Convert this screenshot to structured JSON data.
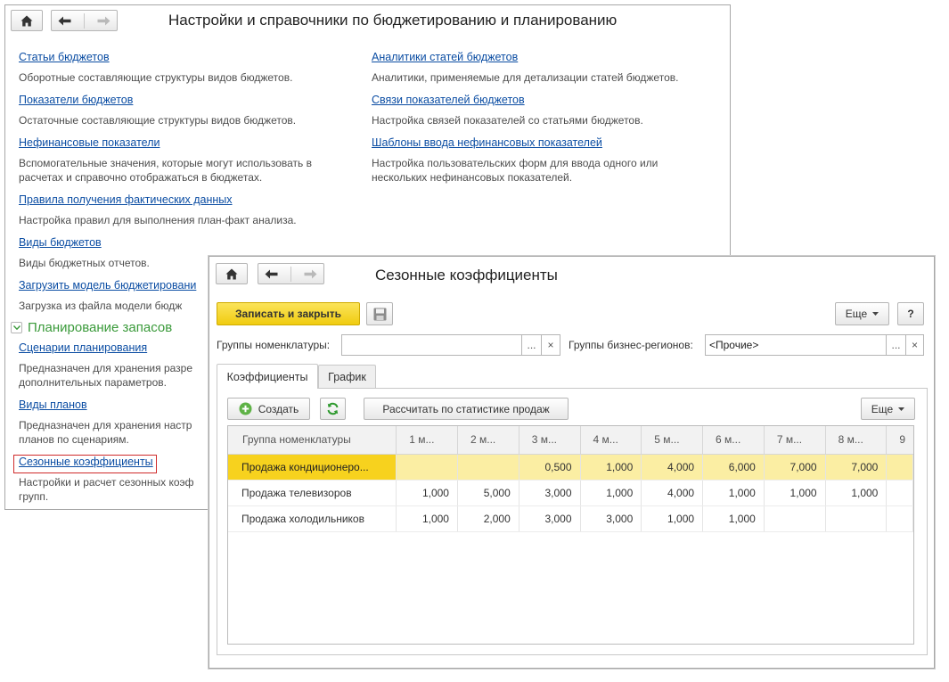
{
  "settings_window": {
    "title": "Настройки и справочники по бюджетированию и планированию",
    "left_column": [
      {
        "link": "Статьи бюджетов",
        "desc": [
          "Оборотные составляющие структуры видов бюджетов."
        ]
      },
      {
        "link": "Показатели бюджетов",
        "desc": [
          "Остаточные составляющие структуры видов бюджетов."
        ]
      },
      {
        "link": "Нефинансовые показатели",
        "desc": [
          "Вспомогательные значения, которые могут использовать в",
          "расчетах и справочно отображаться в бюджетах."
        ]
      },
      {
        "link": "Правила получения фактических данных",
        "desc": [
          "Настройка правил для выполнения план-факт анализа."
        ]
      },
      {
        "link": "Виды бюджетов",
        "desc": [
          "Виды бюджетных отчетов."
        ]
      },
      {
        "link": "Загрузить модель бюджетировани",
        "desc": [
          "Загрузка из файла модели бюдж"
        ]
      }
    ],
    "right_column": [
      {
        "link": "Аналитики статей бюджетов",
        "desc": [
          "Аналитики, применяемые для детализации статей бюджетов."
        ]
      },
      {
        "link": "Связи показателей бюджетов",
        "desc": [
          "Настройка связей показателей со статьями бюджетов."
        ]
      },
      {
        "link": "Шаблоны ввода нефинансовых показателей",
        "desc": [
          "Настройка пользовательских форм для ввода одного или",
          "нескольких нефинансовых показателей."
        ]
      }
    ],
    "group_title": "Планирование запасов",
    "group_items": [
      {
        "link": "Сценарии планирования",
        "desc": [
          "Предназначен для хранения разре",
          "дополнительных параметров."
        ]
      },
      {
        "link": "Виды планов",
        "desc": [
          "Предназначен для хранения настр",
          "планов по сценариям."
        ]
      },
      {
        "link": "Сезонные коэффициенты",
        "desc": [
          "Настройки и расчет сезонных коэф",
          "групп."
        ]
      }
    ]
  },
  "seasonal_window": {
    "title": "Сезонные коэффициенты",
    "save_close": "Записать и закрыть",
    "more": "Еще",
    "help": "?",
    "nomenclature_groups_label": "Группы номенклатуры:",
    "nomenclature_groups_value": "",
    "regions_label": "Группы бизнес-регионов:",
    "regions_value": "<Прочие>",
    "ellipsis": "...",
    "clear": "×",
    "tabs": [
      "Коэффициенты",
      "График"
    ],
    "create": "Создать",
    "calc": "Рассчитать по статистике продаж",
    "grid_more": "Еще",
    "columns": [
      "Группа номенклатуры",
      "1 м...",
      "2 м...",
      "3 м...",
      "4 м...",
      "5 м...",
      "6 м...",
      "7 м...",
      "8 м...",
      "9"
    ],
    "rows": [
      [
        "Продажа кондиционеро...",
        "",
        "",
        "0,500",
        "1,000",
        "4,000",
        "6,000",
        "7,000",
        "7,000",
        ""
      ],
      [
        "Продажа телевизоров",
        "1,000",
        "5,000",
        "3,000",
        "1,000",
        "4,000",
        "1,000",
        "1,000",
        "1,000",
        ""
      ],
      [
        "Продажа холодильников",
        "1,000",
        "2,000",
        "3,000",
        "3,000",
        "1,000",
        "1,000",
        "",
        "",
        ""
      ]
    ]
  },
  "colors": {
    "link": "#0b4da3",
    "group": "#3a9a3a",
    "accent_button": "#f5d31a",
    "selected_row": "#fbeea3",
    "highlight": "#d02a2a"
  },
  "icons": [
    "home-icon",
    "back-arrow-icon",
    "forward-arrow-icon",
    "save-disk-icon",
    "add-icon",
    "refresh-icon",
    "chevron-down-icon"
  ]
}
